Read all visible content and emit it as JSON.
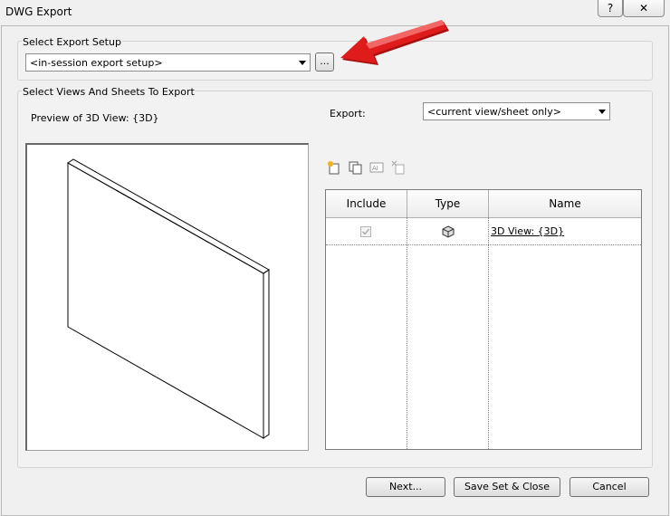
{
  "window": {
    "title": "DWG Export",
    "help_label": "?",
    "close_label": "✕"
  },
  "export_setup": {
    "group_label": "Select Export Setup",
    "selected": "<in-session export setup>",
    "browse_label": "..."
  },
  "views": {
    "group_label": "Select Views And Sheets To Export",
    "preview_label": "Preview of 3D View: {3D}",
    "export_label": "Export:",
    "export_selected": "<current view/sheet only>",
    "columns": [
      "Include",
      "Type",
      "Name"
    ],
    "rows": [
      {
        "include": true,
        "type_icon": "3d-view-icon",
        "name": "3D View: {3D}"
      }
    ]
  },
  "buttons": {
    "next": "Next...",
    "save": "Save Set & Close",
    "cancel": "Cancel"
  },
  "colors": {
    "arrow": "#e01b1b"
  }
}
